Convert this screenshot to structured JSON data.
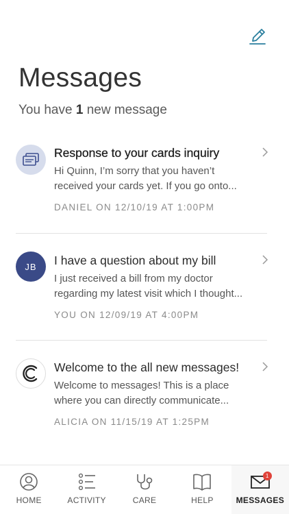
{
  "header": {
    "title": "Messages",
    "subtitle_prefix": "You have",
    "new_count": "1",
    "subtitle_suffix": "new message"
  },
  "messages": [
    {
      "title": "Response to your cards inquiry",
      "preview_line1": "Hi Quinn, I’m sorry that you haven’t",
      "preview_line2": "received your cards yet. If you go onto...",
      "meta": "DANIEL ON 12/10/19 AT 1:00PM",
      "avatar_icon": "cards-icon",
      "unread": true
    },
    {
      "title": "I have a question about my bill",
      "preview_line1": "I just received a bill from my doctor",
      "preview_line2": "regarding my latest visit which I thought...",
      "meta": "YOU ON 12/09/19 AT 4:00PM",
      "avatar_initials": "JB",
      "unread": false
    },
    {
      "title": "Welcome to the all new messages!",
      "preview_line1": "Welcome to messages! This is a place",
      "preview_line2": "where you can directly communicate...",
      "meta": "ALICIA ON 11/15/19 AT 1:25PM",
      "avatar_icon": "brand-logo-icon",
      "unread": false
    }
  ],
  "tabbar": {
    "tabs": [
      {
        "label": "HOME",
        "icon": "user-circle-icon"
      },
      {
        "label": "ACTIVITY",
        "icon": "list-icon"
      },
      {
        "label": "CARE",
        "icon": "stethoscope-icon"
      },
      {
        "label": "HELP",
        "icon": "book-icon"
      },
      {
        "label": "MESSAGES",
        "icon": "envelope-icon",
        "active": true,
        "badge": "1"
      }
    ]
  },
  "colors": {
    "accent": "#2a7f9e",
    "avatar_cards_bg": "#d6dcec",
    "avatar_cards_icon": "#3d4f8f",
    "avatar_initials_bg": "#3a4a87",
    "badge": "#e0433a"
  }
}
